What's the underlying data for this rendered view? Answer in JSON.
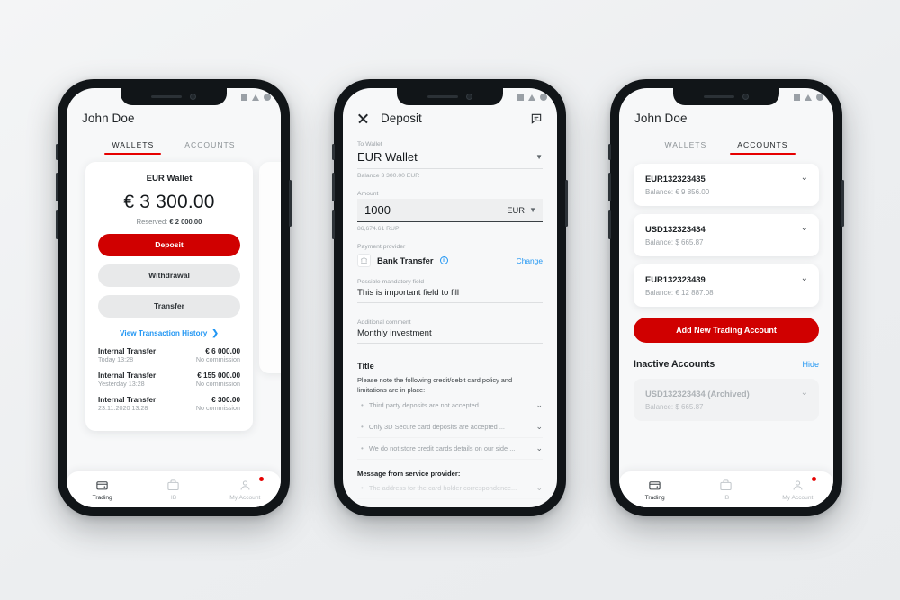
{
  "phone1": {
    "header": {
      "user_name": "John Doe"
    },
    "tabs": [
      {
        "label": "WALLETS",
        "active": true
      },
      {
        "label": "ACCOUNTS",
        "active": false
      }
    ],
    "wallet_card": {
      "title": "EUR Wallet",
      "amount": "€ 3 300.00",
      "reserved_label": "Reserved:",
      "reserved_value": "€ 2 000.00",
      "buttons": {
        "deposit": "Deposit",
        "withdrawal": "Withdrawal",
        "transfer": "Transfer"
      },
      "history_link": "View Transaction History",
      "transactions": [
        {
          "name": "Internal Transfer",
          "amount": "€ 6 000.00",
          "date": "Today 13:28",
          "commission": "No commission"
        },
        {
          "name": "Internal Transfer",
          "amount": "€ 155 000.00",
          "date": "Yesterday 13:28",
          "commission": "No commission"
        },
        {
          "name": "Internal Transfer",
          "amount": "€ 300.00",
          "date": "23.11.2020 13:28",
          "commission": "No commission"
        }
      ]
    },
    "nav": [
      {
        "label": "Trading",
        "icon": "wallet-icon",
        "active": true,
        "badge": false
      },
      {
        "label": "IB",
        "icon": "briefcase-icon",
        "active": false,
        "badge": false
      },
      {
        "label": "My Account",
        "icon": "person-icon",
        "active": false,
        "badge": true
      }
    ]
  },
  "phone2": {
    "header": {
      "close_icon": "close-icon",
      "title": "Deposit",
      "chat_icon": "chat-icon"
    },
    "to_wallet": {
      "label": "To Wallet",
      "value": "EUR Wallet",
      "balance_hint": "Balance 3 300.00 EUR"
    },
    "amount": {
      "label": "Amount",
      "value": "1000",
      "currency": "EUR",
      "converted_hint": "86,674.61 RUP"
    },
    "payment_provider": {
      "label": "Payment provider",
      "name": "Bank Transfer",
      "info_icon": "info-icon",
      "change_label": "Change"
    },
    "mandatory_field": {
      "label": "Possible mandatory field",
      "value": "This is important field to fill"
    },
    "additional_comment": {
      "label": "Additional comment",
      "value": "Monthly investment"
    },
    "notes": {
      "title": "Title",
      "body": "Please note the following credit/debit card policy and limitations are in place:",
      "items": [
        "Third party deposits are not accepted ...",
        "Only 3D Secure card deposits are accepted ...",
        "We do not store credit cards details on our side ..."
      ],
      "subtitle": "Message from service provider:",
      "provider_item": "The address for the card holder correspondence..."
    }
  },
  "phone3": {
    "header": {
      "user_name": "John Doe"
    },
    "tabs": [
      {
        "label": "WALLETS",
        "active": false
      },
      {
        "label": "ACCOUNTS",
        "active": true
      }
    ],
    "accounts": [
      {
        "id": "EUR132323435",
        "balance": "Balance: € 9 856.00"
      },
      {
        "id": "USD132323434",
        "balance": "Balance: $ 665.87"
      },
      {
        "id": "EUR132323439",
        "balance": "Balance: € 12 887.08"
      }
    ],
    "add_account_label": "Add New Trading Account",
    "inactive": {
      "title": "Inactive Accounts",
      "hide_label": "Hide",
      "accounts": [
        {
          "id": "USD132323434 (Archived)",
          "balance": "Balance: $ 665.87"
        }
      ]
    },
    "nav": [
      {
        "label": "Trading",
        "icon": "wallet-icon",
        "active": true,
        "badge": false
      },
      {
        "label": "IB",
        "icon": "briefcase-icon",
        "active": false,
        "badge": false
      },
      {
        "label": "My Account",
        "icon": "person-icon",
        "active": false,
        "badge": true
      }
    ]
  },
  "colors": {
    "brand_red": "#d00000",
    "tab_underline": "#e60000",
    "link_blue": "#2196f3",
    "frame_black": "#111518",
    "canvas": "#eceef0"
  }
}
